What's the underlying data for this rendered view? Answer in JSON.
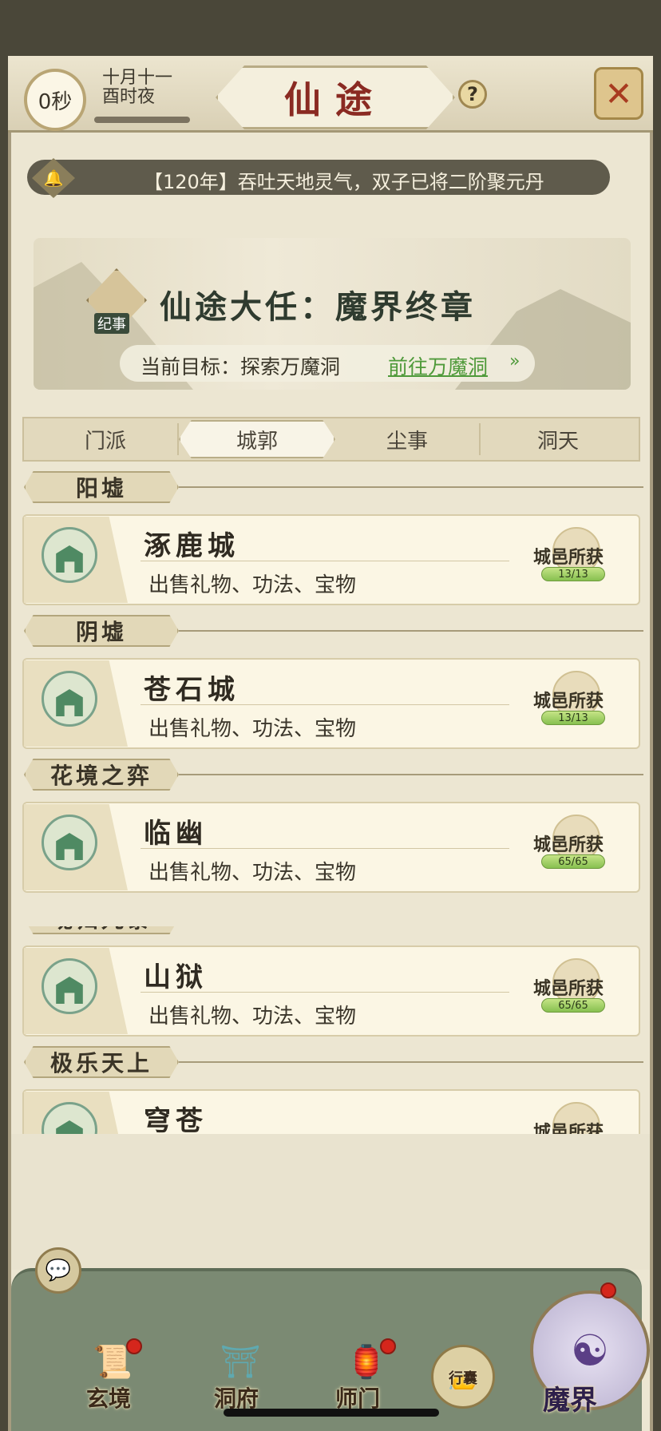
{
  "header": {
    "timer": "0秒",
    "date_line1": "十月十一",
    "date_line2": "酉时夜",
    "title": "仙途",
    "help_icon": "help-icon",
    "close_icon": "close-icon"
  },
  "notice": {
    "text": "【120年】吞吐天地灵气，双子已将二阶聚元丹"
  },
  "banner": {
    "seal_label": "纪事",
    "title": "仙途大任：魔界终章",
    "goal_label": "当前目标：探索万魔洞",
    "goal_link": "前往万魔洞",
    "goal_arrow": "»"
  },
  "tabs": [
    "门派",
    "城郭",
    "尘事",
    "洞天"
  ],
  "active_tab": "城郭",
  "sections": [
    {
      "header": "阳墟",
      "city": "涿鹿城",
      "desc": "出售礼物、功法、宝物",
      "reward_label": "城邑所获",
      "progress": "13/13"
    },
    {
      "header": "阴墟",
      "city": "苍石城",
      "desc": "出售礼物、功法、宝物",
      "reward_label": "城邑所获",
      "progress": "13/13"
    },
    {
      "header": "花境之弈",
      "city": "临幽",
      "desc": "出售礼物、功法、宝物",
      "reward_label": "城邑所获",
      "progress": "65/65"
    },
    {
      "header": "魂归九黎",
      "city": "山狱",
      "desc": "出售礼物、功法、宝物",
      "reward_label": "城邑所获",
      "progress": "65/65"
    },
    {
      "header": "极乐天上",
      "city": "穹苍",
      "desc": "",
      "reward_label": "城邑所获",
      "progress": ""
    }
  ],
  "nav": {
    "items": [
      "玄境",
      "洞府",
      "师门",
      "行囊",
      "魔界"
    ],
    "chat_icon": "chat-icon"
  },
  "colors": {
    "accent_red": "#8a2a22",
    "link_green": "#4f9a3a",
    "progress_green": "#87c050",
    "nav_green": "#7b8a73"
  }
}
